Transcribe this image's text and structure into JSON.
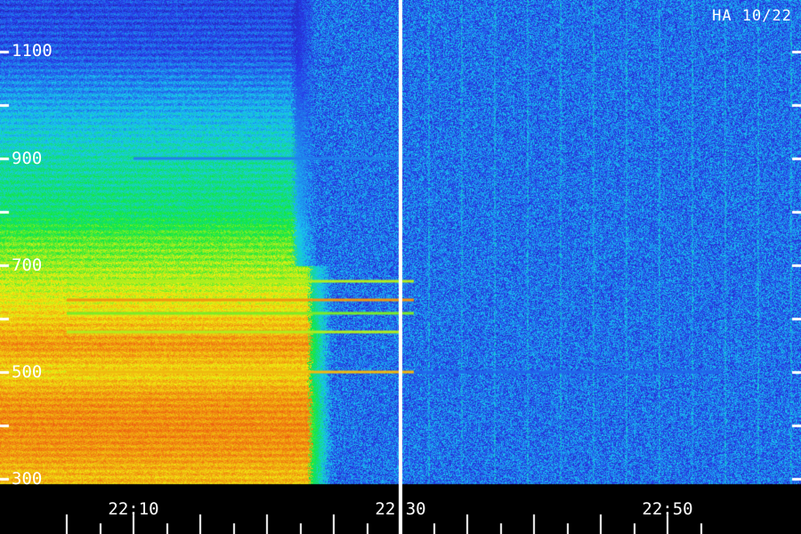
{
  "chart_data": {
    "type": "heatmap",
    "title": "HA 10/22",
    "x_tick_labels": [
      "22:10",
      "22:30",
      "22:50"
    ],
    "y_tick_labels": [
      "1100",
      "900",
      "700",
      "500",
      "300"
    ],
    "yticks": [
      1100,
      900,
      700,
      500,
      300
    ],
    "ylim": [
      290,
      1200
    ],
    "xlim": [
      "22:05",
      "22:54"
    ],
    "x_minor_tick_step_minutes": 2.5,
    "marker_line_time": "22:30",
    "colormap": [
      "#1a0a5a",
      "#2838e8",
      "#18c8f0",
      "#10e840",
      "#f0f010",
      "#f08010",
      "#e82810"
    ],
    "grid": false,
    "broadband_emission": {
      "time_range": [
        "22:05",
        "22:22"
      ],
      "frequency_range": [
        300,
        1200
      ],
      "intensity_by_frequency": [
        {
          "freq": 1200,
          "intensity": 0.18
        },
        {
          "freq": 1100,
          "intensity": 0.2
        },
        {
          "freq": 1000,
          "intensity": 0.3
        },
        {
          "freq": 900,
          "intensity": 0.4
        },
        {
          "freq": 800,
          "intensity": 0.45
        },
        {
          "freq": 750,
          "intensity": 0.55
        },
        {
          "freq": 700,
          "intensity": 0.6
        },
        {
          "freq": 650,
          "intensity": 0.65
        },
        {
          "freq": 600,
          "intensity": 0.72
        },
        {
          "freq": 550,
          "intensity": 0.8
        },
        {
          "freq": 500,
          "intensity": 0.7
        },
        {
          "freq": 450,
          "intensity": 0.8
        },
        {
          "freq": 400,
          "intensity": 0.82
        },
        {
          "freq": 350,
          "intensity": 0.8
        },
        {
          "freq": 310,
          "intensity": 0.75
        }
      ]
    },
    "narrowband_lines": [
      {
        "freq": 900,
        "intensity": 0.25,
        "time_range": [
          "22:10",
          "22:31"
        ]
      },
      {
        "freq": 670,
        "intensity": 0.62,
        "time_range": [
          "22:05",
          "22:31"
        ]
      },
      {
        "freq": 635,
        "intensity": 0.8,
        "time_range": [
          "22:05",
          "22:31"
        ]
      },
      {
        "freq": 610,
        "intensity": 0.58,
        "time_range": [
          "22:05",
          "22:31"
        ]
      },
      {
        "freq": 575,
        "intensity": 0.62,
        "time_range": [
          "22:05",
          "22:30"
        ]
      },
      {
        "freq": 500,
        "intensity": 0.75,
        "time_range": [
          "22:05",
          "22:31"
        ]
      },
      {
        "freq": 500,
        "intensity": 0.22,
        "time_range": [
          "22:31",
          "22:54"
        ]
      }
    ]
  }
}
